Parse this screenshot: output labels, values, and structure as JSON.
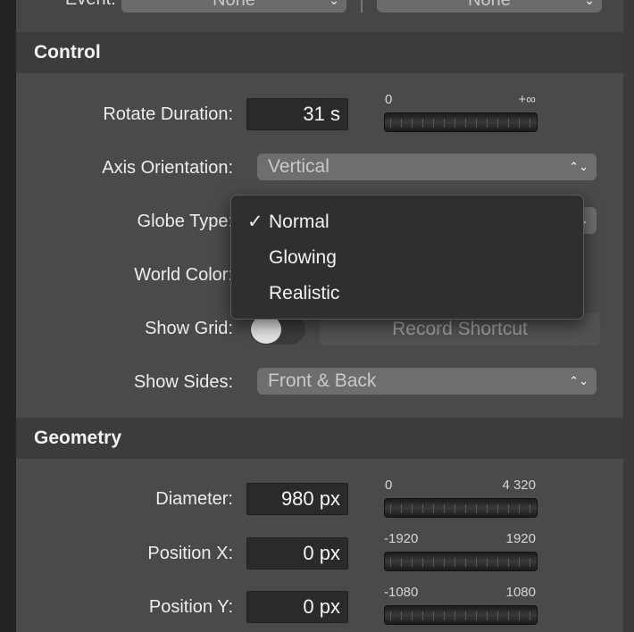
{
  "top": {
    "event_label": "Event:",
    "event_value": "None",
    "second_value": "None"
  },
  "control": {
    "title": "Control",
    "rotate_duration": {
      "label": "Rotate Duration:",
      "value": "31 s",
      "min": "0",
      "max": "+∞"
    },
    "axis_orientation": {
      "label": "Axis Orientation:",
      "value": "Vertical"
    },
    "globe_type": {
      "label": "Globe Type:",
      "options": [
        "Normal",
        "Glowing",
        "Realistic"
      ],
      "selected": "Normal"
    },
    "world_color": {
      "label": "World Color:"
    },
    "show_grid": {
      "label": "Show Grid:",
      "on": false,
      "shortcut_label": "Record Shortcut"
    },
    "show_sides": {
      "label": "Show Sides:",
      "value": "Front & Back"
    }
  },
  "geometry": {
    "title": "Geometry",
    "diameter": {
      "label": "Diameter:",
      "value": "980 px",
      "min": "0",
      "max": "4 320"
    },
    "position_x": {
      "label": "Position X:",
      "value": "0 px",
      "min": "-1920",
      "max": "1920"
    },
    "position_y": {
      "label": "Position Y:",
      "value": "0 px",
      "min": "-1080",
      "max": "1080"
    }
  },
  "menu": {
    "check_glyph": "✓"
  },
  "icons": {
    "popup_chevron": "up-down-chevron-icon"
  },
  "colors": {
    "panel": "#4a4a4a",
    "header": "#3c3c3c",
    "field": "#2a2a2a",
    "menu": "#2f2f2f"
  }
}
